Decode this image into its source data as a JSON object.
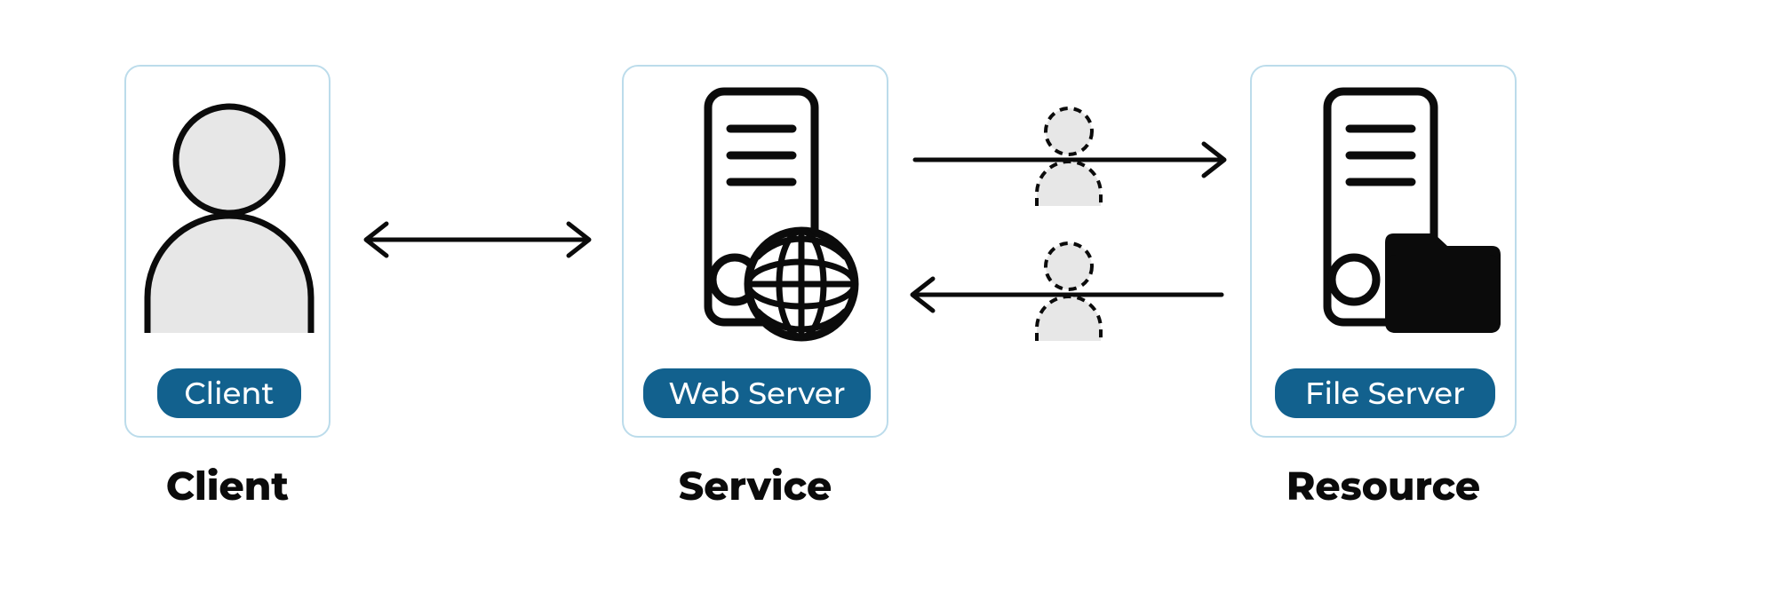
{
  "nodes": {
    "client": {
      "badge": "Client",
      "title": "Client"
    },
    "service": {
      "badge": "Web Server",
      "title": "Service"
    },
    "resource": {
      "badge": "File Server",
      "title": "Resource"
    }
  },
  "colors": {
    "accent": "#12618e",
    "box_border": "#bcdceb",
    "fill_light": "#e7e7e7",
    "stroke_dark": "#0b0b0b"
  }
}
